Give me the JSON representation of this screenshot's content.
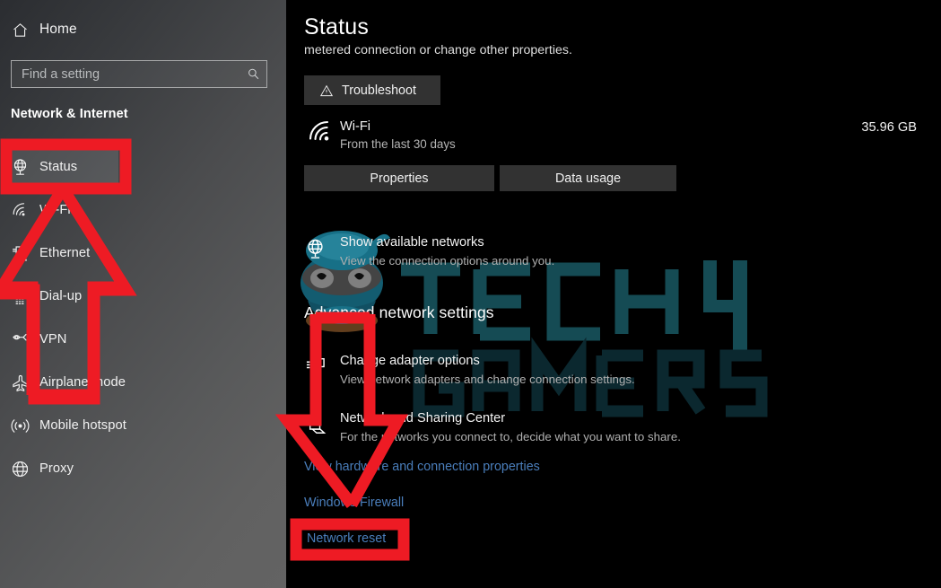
{
  "sidebar": {
    "home": {
      "label": "Home",
      "icon": "home-icon"
    },
    "search": {
      "value": "",
      "placeholder": "Find a setting",
      "icon": "search-icon"
    },
    "category_title": "Network & Internet",
    "items": [
      {
        "label": "Status",
        "icon": "globe-status-icon",
        "selected": true
      },
      {
        "label": "Wi-Fi",
        "icon": "wifi-icon",
        "selected": false
      },
      {
        "label": "Ethernet",
        "icon": "ethernet-icon",
        "selected": false
      },
      {
        "label": "Dial-up",
        "icon": "dialup-icon",
        "selected": false
      },
      {
        "label": "VPN",
        "icon": "vpn-icon",
        "selected": false
      },
      {
        "label": "Airplane mode",
        "icon": "airplane-icon",
        "selected": false
      },
      {
        "label": "Mobile hotspot",
        "icon": "hotspot-icon",
        "selected": false
      },
      {
        "label": "Proxy",
        "icon": "globe-icon",
        "selected": false
      }
    ]
  },
  "main": {
    "page_title": "Status",
    "clipped_line": "metered connection or change other properties.",
    "troubleshoot_button": {
      "label": "Troubleshoot",
      "icon": "warning-triangle-icon"
    },
    "data_usage": {
      "icon": "wifi-icon",
      "name": "Wi-Fi",
      "subtitle": "From the last 30 days",
      "amount": "35.96 GB",
      "properties_button": "Properties",
      "data_usage_button": "Data usage"
    },
    "show_networks": {
      "icon": "globe-networks-icon",
      "title": "Show available networks",
      "subtitle": "View the connection options around you."
    },
    "advanced_heading": "Advanced network settings",
    "change_adapter": {
      "icon": "adapter-icon",
      "title": "Change adapter options",
      "subtitle": "View network adapters and change connection settings."
    },
    "sharing_center": {
      "icon": "sharing-icon",
      "title": "Network and Sharing Center",
      "subtitle": "For the networks you connect to, decide what you want to share."
    },
    "links": [
      "View hardware and connection properties",
      "Windows Firewall",
      "Network reset"
    ]
  },
  "watermark": {
    "text_top": "TECH 4",
    "text_bottom": "GAMERS",
    "color": "#17525c"
  },
  "annotations": {
    "highlight_color": "#ee1b24",
    "status_box": "red rectangle around Status sidebar item",
    "network_reset_box": "red rectangle around Network reset link",
    "up_arrow": "red outlined arrow pointing up to Status",
    "down_arrow": "red outlined arrow pointing down to Network reset"
  },
  "colors": {
    "accent_red": "#ee1b24",
    "link_blue": "#4a7ebb",
    "button_gray": "#323232",
    "panel_black": "#000000"
  }
}
